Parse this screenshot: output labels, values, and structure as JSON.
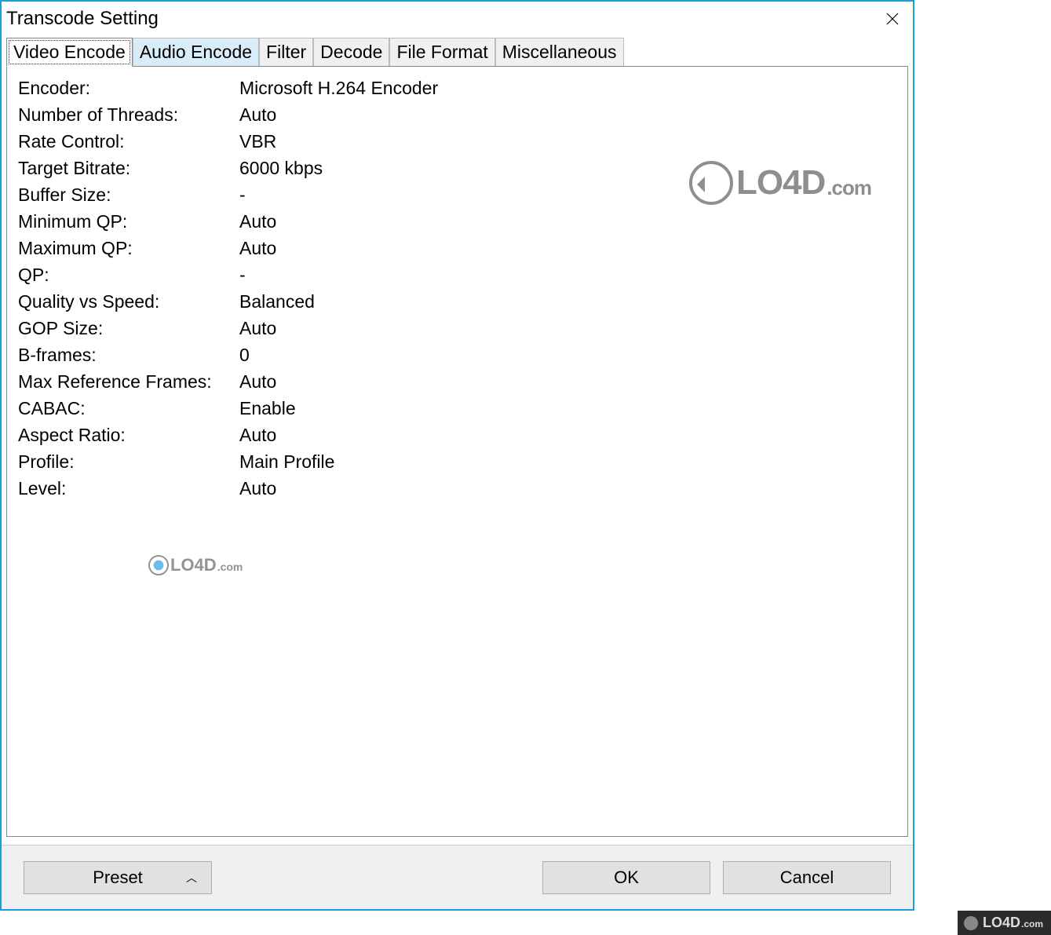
{
  "window": {
    "title": "Transcode Setting"
  },
  "tabs": [
    {
      "id": "video-encode",
      "label": "Video Encode",
      "active": true
    },
    {
      "id": "audio-encode",
      "label": "Audio Encode",
      "active": false,
      "hover": true
    },
    {
      "id": "filter",
      "label": "Filter",
      "active": false
    },
    {
      "id": "decode",
      "label": "Decode",
      "active": false
    },
    {
      "id": "file-format",
      "label": "File Format",
      "active": false
    },
    {
      "id": "miscellaneous",
      "label": "Miscellaneous",
      "active": false
    }
  ],
  "properties": [
    {
      "label": "Encoder:",
      "value": "Microsoft H.264 Encoder"
    },
    {
      "label": "Number of Threads:",
      "value": "Auto"
    },
    {
      "label": "Rate Control:",
      "value": "VBR"
    },
    {
      "label": "Target Bitrate:",
      "value": "6000 kbps"
    },
    {
      "label": "Buffer Size:",
      "value": "-"
    },
    {
      "label": "Minimum QP:",
      "value": "Auto"
    },
    {
      "label": "Maximum QP:",
      "value": "Auto"
    },
    {
      "label": "QP:",
      "value": "-"
    },
    {
      "label": "Quality vs Speed:",
      "value": "Balanced"
    },
    {
      "label": "GOP Size:",
      "value": "Auto"
    },
    {
      "label": "B-frames:",
      "value": "0"
    },
    {
      "label": "Max Reference Frames:",
      "value": "Auto"
    },
    {
      "label": "CABAC:",
      "value": "Enable"
    },
    {
      "label": "Aspect Ratio:",
      "value": "Auto"
    },
    {
      "label": "Profile:",
      "value": "Main Profile"
    },
    {
      "label": "Level:",
      "value": "Auto"
    }
  ],
  "buttons": {
    "preset": "Preset",
    "ok": "OK",
    "cancel": "Cancel"
  },
  "watermark": {
    "text_main": "LO4D",
    "text_suffix": ".com"
  }
}
